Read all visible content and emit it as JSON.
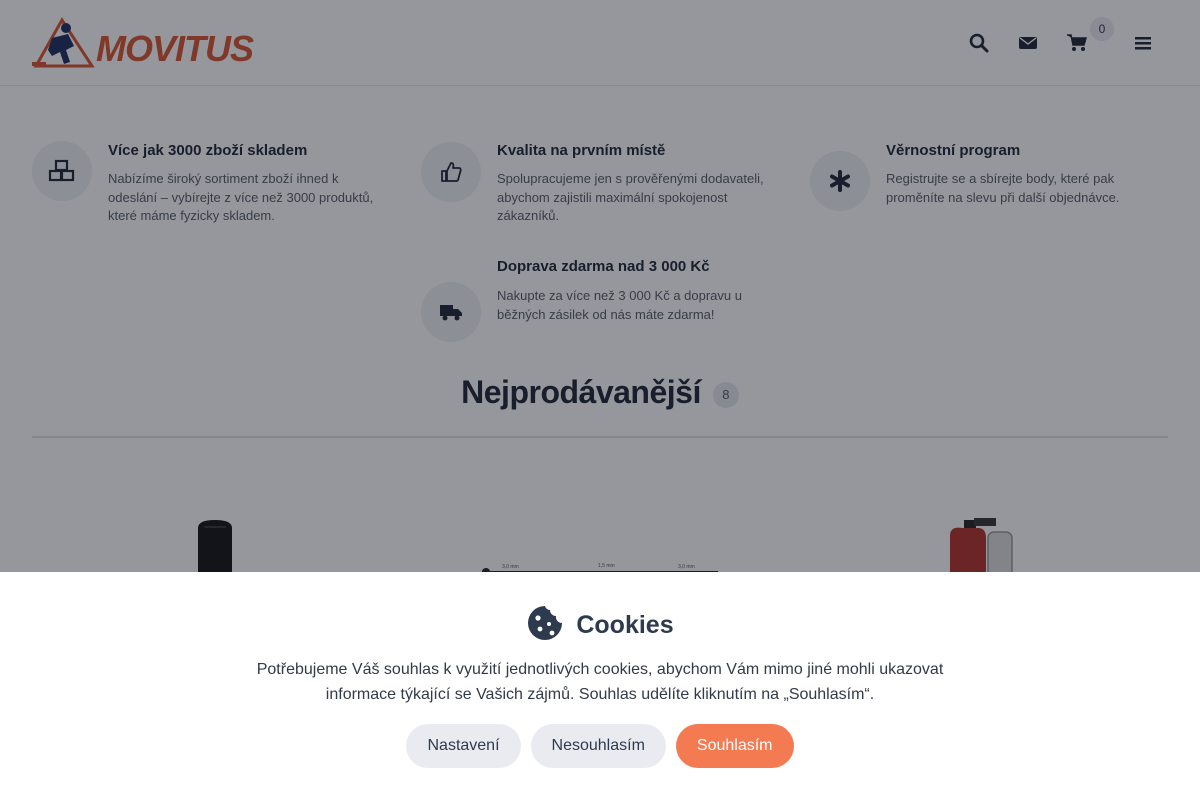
{
  "header": {
    "logo_text": "MOVITUS",
    "cart_count": "0",
    "icons": [
      "search-icon",
      "envelope-icon",
      "cart-icon",
      "menu-icon"
    ]
  },
  "features": [
    {
      "title": "Více jak 3000 zboží skladem",
      "desc": "Nabízíme široký sortiment zboží ihned k odeslání – vybírejte z více než 3000 produktů, které máme fyzicky skladem.",
      "icon": "boxes-icon"
    },
    {
      "title": "Kvalita na prvním místě",
      "desc": "Spolupracujeme jen s prověřenými dodavateli, abychom zajistili maximální spokojenost zákazníků.",
      "icon": "thumbs-up-icon"
    },
    {
      "title": "Věrnostní program",
      "desc": "Registrujte se a sbírejte body, které pak proměníte na slevu při další objednávce.",
      "icon": "asterisk-icon"
    },
    {
      "title": "Doprava zdarma nad 3 000 Kč",
      "desc": "Nakupte za více než 3 000 Kč a dopravu u běžných zásilek od nás máte zdarma!",
      "icon": "truck-icon"
    }
  ],
  "bestsellers": {
    "title": "Nejprodávanější",
    "count": "8"
  },
  "cookies": {
    "title": "Cookies",
    "text": "Potřebujeme Váš souhlas k využití jednotlivých cookies, abychom Vám mimo jiné mohli ukazovat informace týkající se Vašich zájmů. Souhlas udělíte kliknutím na „Souhlasím“.",
    "btn_settings": "Nastavení",
    "btn_decline": "Nesouhlasím",
    "btn_accept": "Souhlasím"
  },
  "colors": {
    "brand": "#d9542c",
    "accent_button": "#f47a52",
    "overlay": "#141823"
  }
}
